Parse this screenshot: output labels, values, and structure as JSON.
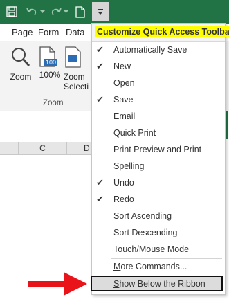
{
  "title_bar": {
    "accent_color": "#217346",
    "icons": [
      "save-icon",
      "undo-icon",
      "redo-icon",
      "new-document-icon",
      "customize-qat-dropdown-icon"
    ]
  },
  "tabs": [
    "Page",
    "Form",
    "Data"
  ],
  "ribbon": {
    "zoom_button": "Zoom",
    "hundred_percent_button": "100%",
    "hundred_icon_text": "100",
    "zoom_selection_line1": "Zoom",
    "zoom_selection_line2": "Selecti",
    "group_label": "Zoom"
  },
  "columns": [
    "C",
    "D"
  ],
  "menu": {
    "title": "Customize Quick Access Toolbar",
    "title_highlight_color": "#ffff00",
    "items": [
      {
        "label": "Automatically Save",
        "checked": true
      },
      {
        "label": "New",
        "checked": true
      },
      {
        "label": "Open",
        "checked": false
      },
      {
        "label": "Save",
        "checked": true
      },
      {
        "label": "Email",
        "checked": false
      },
      {
        "label": "Quick Print",
        "checked": false
      },
      {
        "label": "Print Preview and Print",
        "checked": false
      },
      {
        "label": "Spelling",
        "checked": false
      },
      {
        "label": "Undo",
        "checked": true
      },
      {
        "label": "Redo",
        "checked": true
      },
      {
        "label": "Sort Ascending",
        "checked": false
      },
      {
        "label": "Sort Descending",
        "checked": false
      },
      {
        "label": "Touch/Mouse Mode",
        "checked": false
      }
    ],
    "more_commands_first": "M",
    "more_commands_rest": "ore Commands...",
    "show_below_first": "S",
    "show_below_rest": "how Below the Ribbon",
    "checkmark_glyph": "✔"
  },
  "arrow_color": "#e8141a"
}
